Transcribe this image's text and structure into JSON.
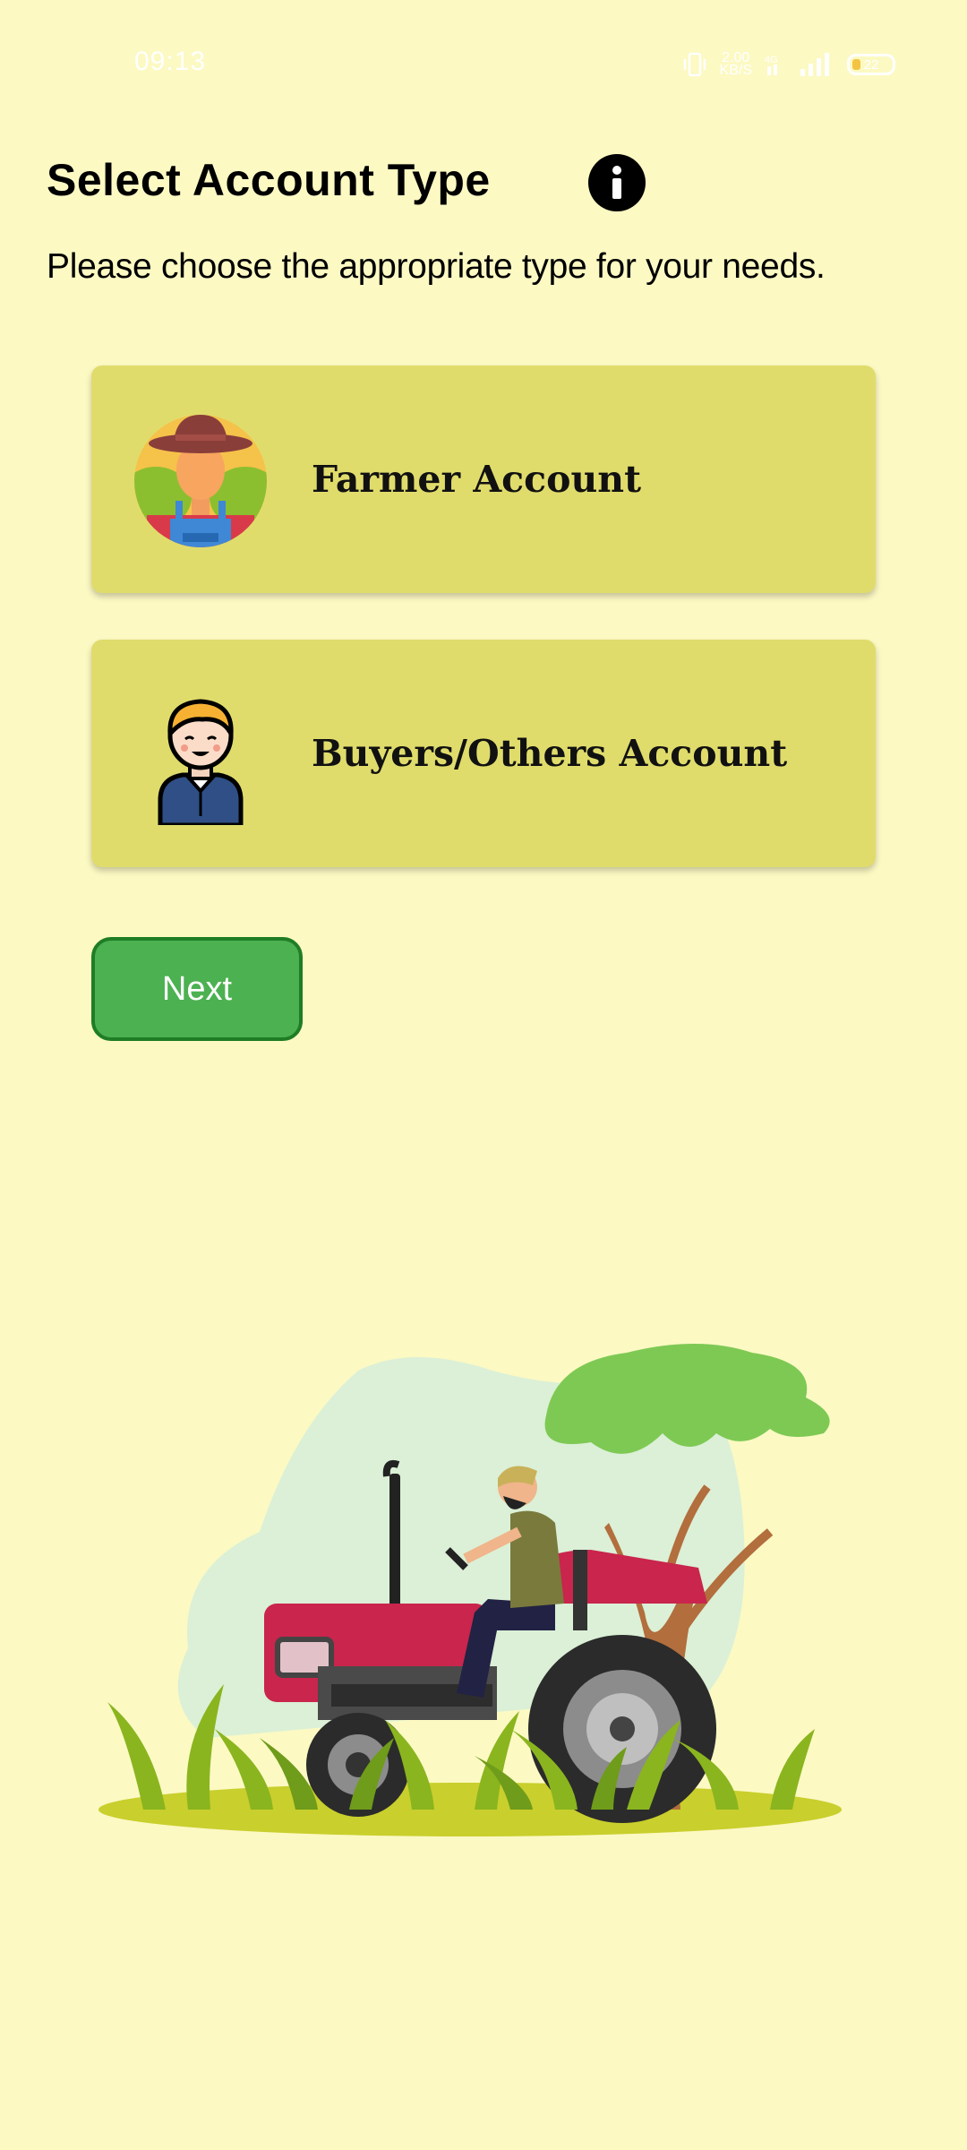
{
  "status_bar": {
    "time": "09:13",
    "net_speed": "2.00\nKB/S",
    "battery": "22",
    "icons": [
      "vibrate-icon",
      "wifi-icon",
      "signal-icon",
      "battery-icon"
    ]
  },
  "header": {
    "title": "Select Account Type",
    "subtitle": "Please choose the appropriate type for your needs.",
    "info_icon": "info-icon"
  },
  "account_types": [
    {
      "label": "Farmer Account",
      "icon": "farmer-avatar-icon"
    },
    {
      "label": "Buyers/Others Account",
      "icon": "buyer-avatar-icon"
    }
  ],
  "actions": {
    "next_label": "Next"
  },
  "colors": {
    "background": "#fcf9c3",
    "card": "#e0dc6c",
    "button": "#4cb151",
    "button_border": "#1f7d25"
  }
}
